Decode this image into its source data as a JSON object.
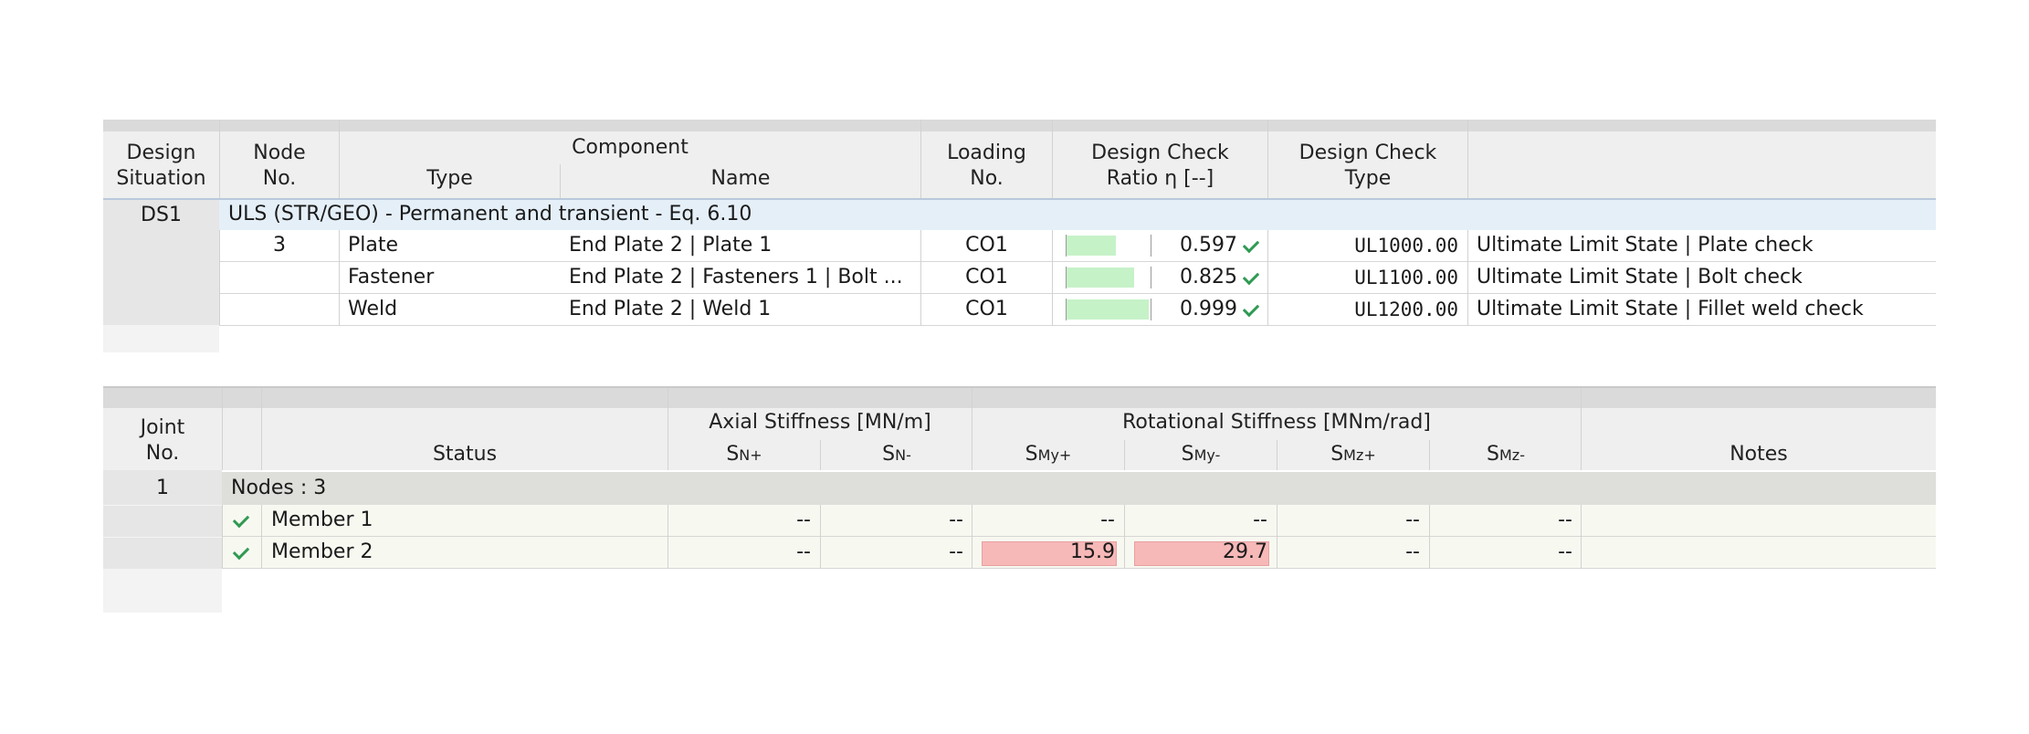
{
  "table1": {
    "headers": {
      "design_situation": [
        "Design",
        "Situation"
      ],
      "node_no": [
        "Node",
        "No."
      ],
      "component": "Component",
      "type": "Type",
      "name": "Name",
      "loading_no": [
        "Loading",
        "No."
      ],
      "ratio": [
        "Design Check",
        "Ratio η [--]"
      ],
      "check_type": [
        "Design Check",
        "Type"
      ]
    },
    "ds_id": "DS1",
    "ds_description": "ULS (STR/GEO) - Permanent and transient - Eq. 6.10",
    "rows": [
      {
        "node": "3",
        "type": "Plate",
        "name": "End Plate 2 | Plate 1",
        "loading": "CO1",
        "ratio": 0.597,
        "ratio_text": "0.597",
        "check_code": "UL1000.00",
        "check_desc": "Ultimate Limit State | Plate check"
      },
      {
        "node": "",
        "type": "Fastener",
        "name": "End Plate 2 | Fasteners 1 | Bolt ...",
        "loading": "CO1",
        "ratio": 0.825,
        "ratio_text": "0.825",
        "check_code": "UL1100.00",
        "check_desc": "Ultimate Limit State | Bolt check"
      },
      {
        "node": "",
        "type": "Weld",
        "name": "End Plate 2 | Weld 1",
        "loading": "CO1",
        "ratio": 0.999,
        "ratio_text": "0.999",
        "check_code": "UL1200.00",
        "check_desc": "Ultimate Limit State | Fillet weld check"
      }
    ],
    "ratio_bar_color": "#c6f2c8"
  },
  "table2": {
    "headers": {
      "joint_no": [
        "Joint",
        "No."
      ],
      "status": "Status",
      "axial": "Axial Stiffness [MN/m]",
      "rotational": "Rotational Stiffness [MNm/rad]",
      "notes": "Notes",
      "sub": [
        {
          "main": "S",
          "sub": "N+"
        },
        {
          "main": "S",
          "sub": "N-"
        },
        {
          "main": "S",
          "sub": "My+"
        },
        {
          "main": "S",
          "sub": "My-"
        },
        {
          "main": "S",
          "sub": "Mz+"
        },
        {
          "main": "S",
          "sub": "Mz-"
        }
      ]
    },
    "joint_id": "1",
    "group_label": "Nodes : 3",
    "rows": [
      {
        "member": "Member 1",
        "values": [
          "--",
          "--",
          "--",
          "--",
          "--",
          "--"
        ],
        "notes": ""
      },
      {
        "member": "Member 2",
        "values": [
          "--",
          "--",
          "15.9",
          "29.7",
          "--",
          "--"
        ],
        "notes": ""
      }
    ],
    "warning_color": "#f7b8b8"
  }
}
